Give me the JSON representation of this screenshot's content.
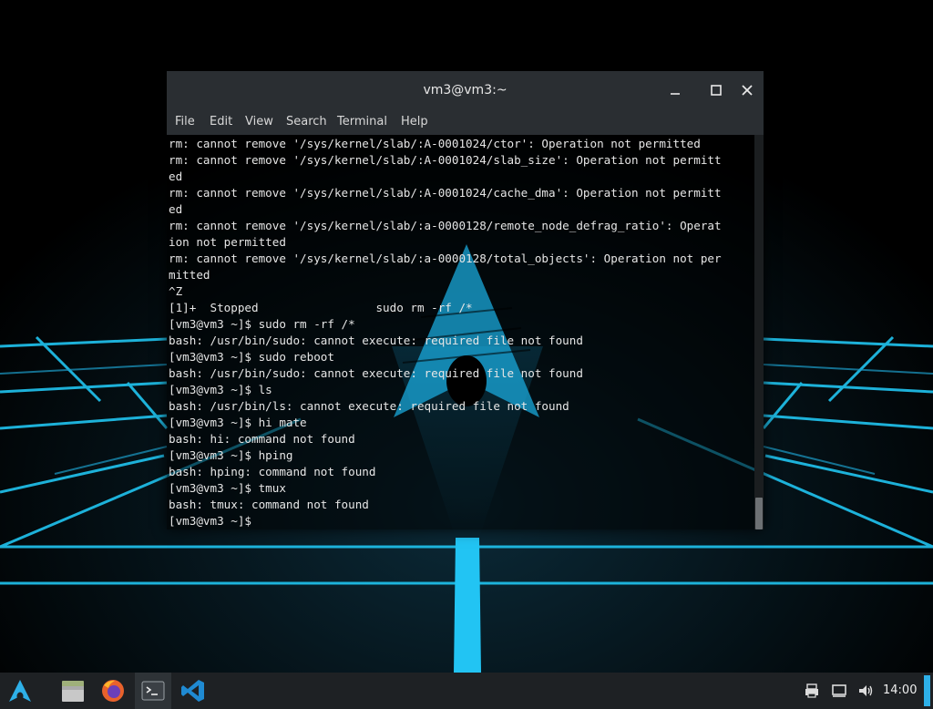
{
  "window": {
    "title": "vm3@vm3:~",
    "controls": [
      "minimize-icon",
      "maximize-icon",
      "close-icon"
    ]
  },
  "menu": [
    "File",
    "Edit",
    "View",
    "Search",
    "Terminal",
    "Help"
  ],
  "terminal_lines": [
    "rm: cannot remove '/sys/kernel/slab/:A-0001024/ctor': Operation not permitted",
    "rm: cannot remove '/sys/kernel/slab/:A-0001024/slab_size': Operation not permitt",
    "ed",
    "rm: cannot remove '/sys/kernel/slab/:A-0001024/cache_dma': Operation not permitt",
    "ed",
    "rm: cannot remove '/sys/kernel/slab/:a-0000128/remote_node_defrag_ratio': Operat",
    "ion not permitted",
    "rm: cannot remove '/sys/kernel/slab/:a-0000128/total_objects': Operation not per",
    "mitted",
    "^Z",
    "[1]+  Stopped                 sudo rm -rf /*",
    "[vm3@vm3 ~]$ sudo rm -rf /*",
    "bash: /usr/bin/sudo: cannot execute: required file not found",
    "[vm3@vm3 ~]$ sudo reboot",
    "bash: /usr/bin/sudo: cannot execute: required file not found",
    "[vm3@vm3 ~]$ ls",
    "bash: /usr/bin/ls: cannot execute: required file not found",
    "[vm3@vm3 ~]$ hi mate",
    "bash: hi: command not found",
    "[vm3@vm3 ~]$ hping",
    "bash: hping: command not found",
    "[vm3@vm3 ~]$ tmux",
    "bash: tmux: command not found",
    "[vm3@vm3 ~]$"
  ],
  "taskbar": {
    "launcher_icon": "arch-logo-icon",
    "apps": [
      "file-manager-icon",
      "firefox-icon",
      "terminal-icon",
      "vscode-icon"
    ],
    "active_app": "terminal-icon",
    "tray": [
      "printer-icon",
      "network-icon",
      "volume-icon"
    ],
    "clock": "14:00"
  },
  "colors": {
    "accent": "#2eb0e8",
    "titlebar": "#2a2e32",
    "taskbar": "#1e2124",
    "terminal_text": "#e6e6e6"
  }
}
